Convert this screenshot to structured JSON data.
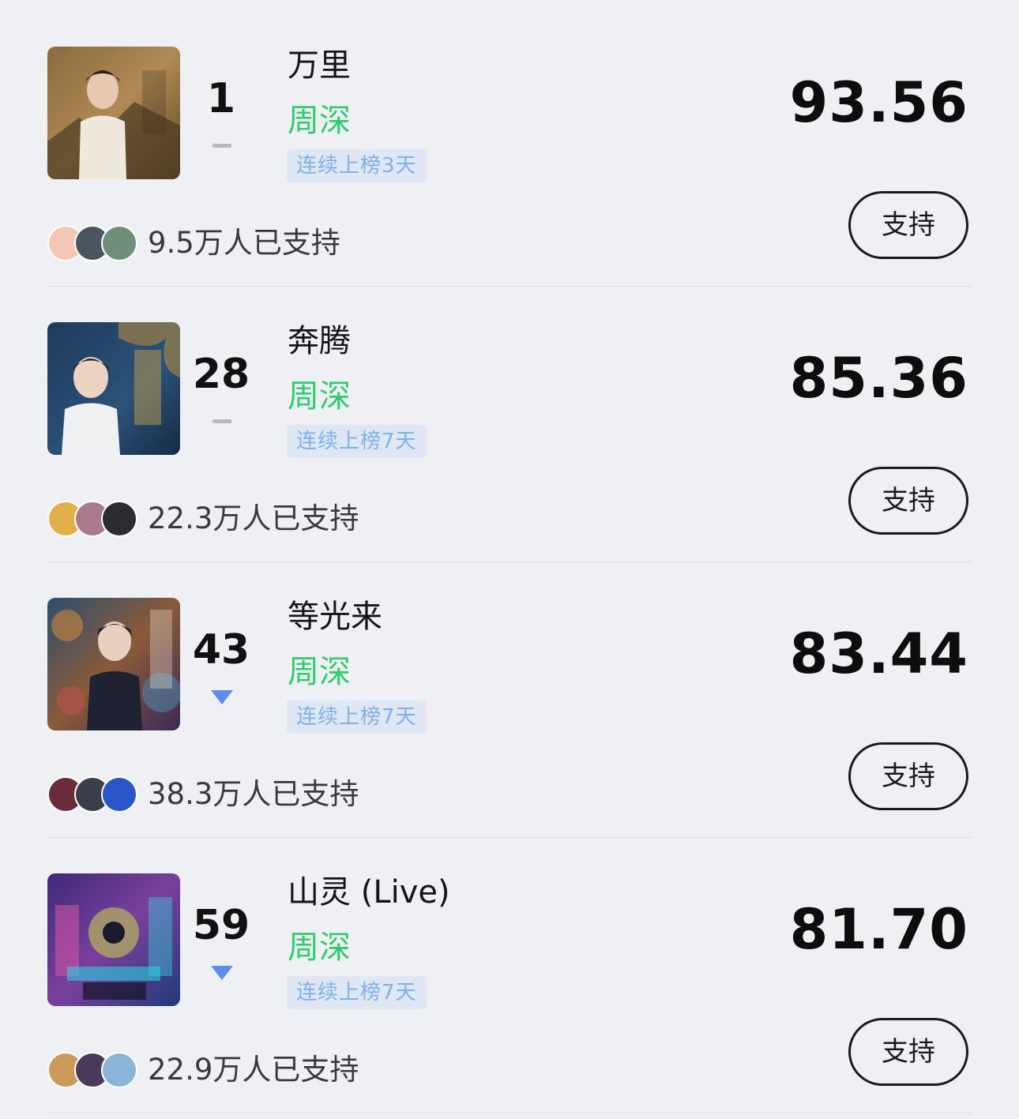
{
  "support_label": "支持",
  "items": [
    {
      "rank": "1",
      "trend": "flat",
      "title": "万里",
      "artist": "周深",
      "streak": "连续上榜3天",
      "score": "93.56",
      "supporters": "9.5万人已支持"
    },
    {
      "rank": "28",
      "trend": "flat",
      "title": "奔腾",
      "artist": "周深",
      "streak": "连续上榜7天",
      "score": "85.36",
      "supporters": "22.3万人已支持"
    },
    {
      "rank": "43",
      "trend": "down",
      "title": "等光来",
      "artist": "周深",
      "streak": "连续上榜7天",
      "score": "83.44",
      "supporters": "38.3万人已支持"
    },
    {
      "rank": "59",
      "trend": "down",
      "title": "山灵 (Live)",
      "artist": "周深",
      "streak": "连续上榜7天",
      "score": "81.70",
      "supporters": "22.9万人已支持"
    }
  ]
}
